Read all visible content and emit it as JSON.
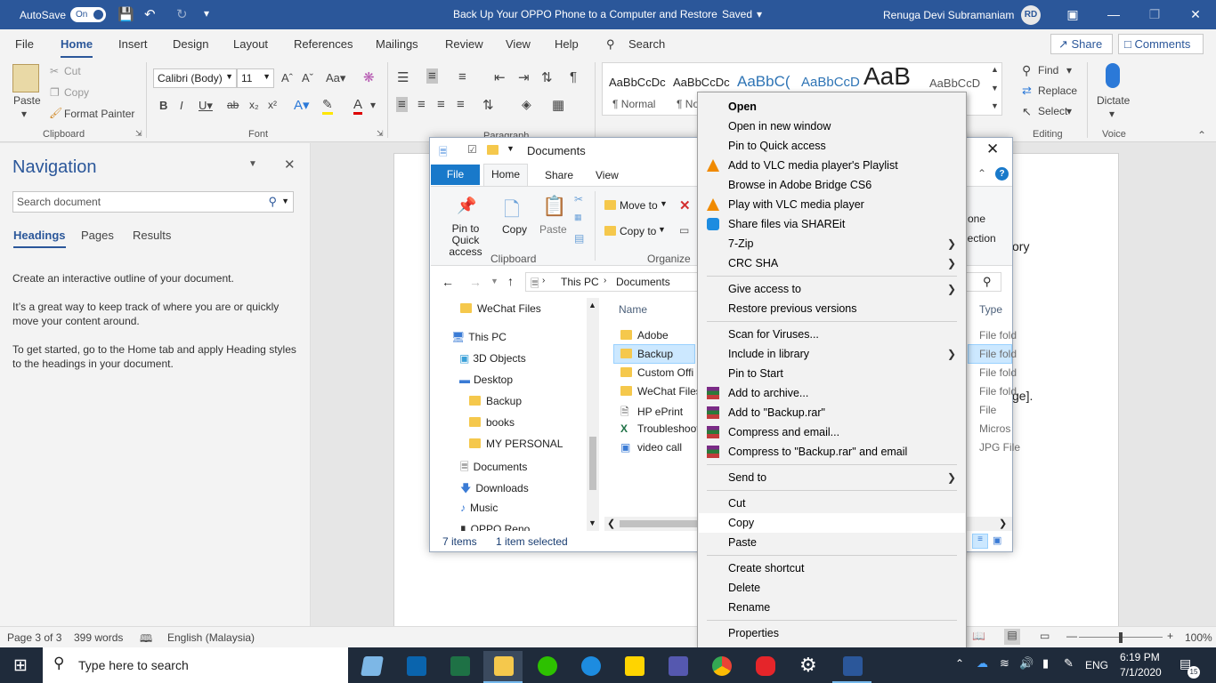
{
  "titlebar": {
    "autosave": "AutoSave",
    "toggle": "On",
    "doc_title": "Back Up Your OPPO Phone to a Computer and Restore",
    "saved": "Saved",
    "user": "Renuga Devi Subramaniam",
    "initials": "RD"
  },
  "ribbon_tabs": [
    "File",
    "Home",
    "Insert",
    "Design",
    "Layout",
    "References",
    "Mailings",
    "Review",
    "View",
    "Help"
  ],
  "search_label": "Search",
  "share": "Share",
  "comments": "Comments",
  "clipboard": {
    "paste": "Paste",
    "cut": "Cut",
    "copy": "Copy",
    "format_painter": "Format Painter",
    "group": "Clipboard"
  },
  "font": {
    "family": "Calibri (Body)",
    "size": "11",
    "group": "Font"
  },
  "paragraph": {
    "group": "Paragraph"
  },
  "styles": [
    {
      "sample": "AaBbCcDc",
      "name": "¶ Normal"
    },
    {
      "sample": "AaBbCcDc",
      "name": "¶ No"
    },
    {
      "sample": "AaBbC(",
      "name": ""
    },
    {
      "sample": "AaBbCcD",
      "name": ""
    },
    {
      "sample": "AaB",
      "name": ""
    },
    {
      "sample": "AaBbCcD",
      "name": ""
    }
  ],
  "editing": {
    "find": "Find",
    "replace": "Replace",
    "select": "Select",
    "group": "Editing"
  },
  "voice": {
    "dictate": "Dictate",
    "group": "Voice"
  },
  "navigation": {
    "title": "Navigation",
    "search_placeholder": "Search document",
    "tabs": [
      "Headings",
      "Pages",
      "Results"
    ],
    "p1": "Create an interactive outline of your document.",
    "p2": "It’s a great way to keep track of where you are or quickly move your content around.",
    "p3": "To get started, go to the Home tab and apply Heading styles to the headings in your document."
  },
  "document_snippets": {
    "right1": "ory",
    "right2": "ge]."
  },
  "status": {
    "page": "Page 3 of 3",
    "words": "399 words",
    "language": "English (Malaysia)",
    "zoom": "100%"
  },
  "explorer": {
    "title": "Documents",
    "tabs": [
      "File",
      "Home",
      "Share",
      "View"
    ],
    "pin": "Pin to Quick access",
    "copy": "Copy",
    "paste": "Paste",
    "move_to": "Move to",
    "copy_to": "Copy to",
    "group_clipboard": "Clipboard",
    "group_organize": "Organize",
    "right_ribbon": [
      "one",
      "lection"
    ],
    "path": [
      "This PC",
      "Documents"
    ],
    "tree": [
      "WeChat Files",
      "This PC",
      "3D Objects",
      "Desktop",
      "Backup",
      "books",
      "MY PERSONAL",
      "Documents",
      "Downloads",
      "Music",
      "OPPO Reno"
    ],
    "col_name": "Name",
    "col_type": "Type",
    "files": [
      {
        "name": "Adobe",
        "type": "File fold"
      },
      {
        "name": "Backup",
        "type": "File fold"
      },
      {
        "name": "Custom Offi",
        "type": "File fold"
      },
      {
        "name": "WeChat Files",
        "type": "File fold"
      },
      {
        "name": "HP ePrint",
        "type": "File"
      },
      {
        "name": "Troubleshoot",
        "type": "Micros"
      },
      {
        "name": "video call",
        "type": "JPG File"
      }
    ],
    "status_items": "7 items",
    "status_selected": "1 item selected"
  },
  "context_menu": [
    {
      "label": "Open",
      "bold": true
    },
    {
      "label": "Open in new window"
    },
    {
      "label": "Pin to Quick access"
    },
    {
      "label": "Add to VLC media player's Playlist",
      "icon": "vlc-icon"
    },
    {
      "label": "Browse in Adobe Bridge CS6"
    },
    {
      "label": "Play with VLC media player",
      "icon": "vlc-icon"
    },
    {
      "label": "Share files via SHAREit",
      "icon": "shareit-icon"
    },
    {
      "label": "7-Zip",
      "submenu": true
    },
    {
      "label": "CRC SHA",
      "submenu": true
    },
    {
      "sep": true
    },
    {
      "label": "Give access to",
      "submenu": true
    },
    {
      "label": "Restore previous versions"
    },
    {
      "sep": true
    },
    {
      "label": "Scan for Viruses..."
    },
    {
      "label": "Include in library",
      "submenu": true
    },
    {
      "label": "Pin to Start"
    },
    {
      "label": "Add to archive...",
      "icon": "winrar-icon"
    },
    {
      "label": "Add to \"Backup.rar\"",
      "icon": "winrar-icon"
    },
    {
      "label": "Compress and email...",
      "icon": "winrar-icon"
    },
    {
      "label": "Compress to \"Backup.rar\" and email",
      "icon": "winrar-icon"
    },
    {
      "sep": true
    },
    {
      "label": "Send to",
      "submenu": true
    },
    {
      "sep": true
    },
    {
      "label": "Cut"
    },
    {
      "label": "Copy",
      "hover": true
    },
    {
      "label": "Paste"
    },
    {
      "sep": true
    },
    {
      "label": "Create shortcut"
    },
    {
      "label": "Delete"
    },
    {
      "label": "Rename"
    },
    {
      "sep": true
    },
    {
      "label": "Properties"
    }
  ],
  "taskbar": {
    "search_placeholder": "Type here to search",
    "lang": "ENG",
    "time": "6:19 PM",
    "date": "7/1/2020",
    "notif": "15"
  }
}
